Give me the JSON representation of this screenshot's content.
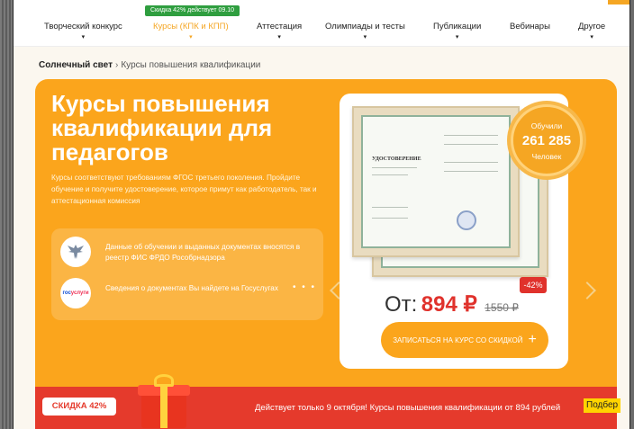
{
  "nav": {
    "promo_badge": "Скидка 42% действует 09.10",
    "items": [
      {
        "label": "Творческий конкурс",
        "chevron": "▾"
      },
      {
        "label": "Курсы (КПК и КПП)",
        "chevron": "▾"
      },
      {
        "label": "Аттестация",
        "chevron": "▾"
      },
      {
        "label": "Олимпиады и тесты",
        "chevron": "▾"
      },
      {
        "label": "Публикации",
        "chevron": "▾"
      },
      {
        "label": "Вебинары",
        "chevron": ""
      },
      {
        "label": "Другое",
        "chevron": "▾"
      }
    ],
    "active_color": "#f5a623"
  },
  "breadcrumb": {
    "home": "Солнечный свет",
    "separator": "›",
    "current": "Курсы повышения квалификации"
  },
  "hero": {
    "title": "Курсы повышения квалификации для педагогов",
    "subtitle": "Курсы соответствуют требованиям ФГОС третьего поколения. Пройдите обучение и получите удостоверение, которое примут как работодатель, так и аттестационная комиссия",
    "info": [
      {
        "icon": "eagle-emblem-icon",
        "text": "Данные об обучении и выданных документах вносятся в реестр ФИС ФРДО Рособрнадзора"
      },
      {
        "icon": "gosuslugi-logo",
        "text": "Сведения о документах Вы найдете на Госуслугах",
        "logo_text_a": "гос",
        "logo_text_b": "услуги"
      }
    ],
    "dots": "• • •",
    "background": "#fba51c"
  },
  "certificate": {
    "heading": "УДОСТОВЕРЕНИЕ"
  },
  "medal": {
    "line1": "Обучили",
    "count": "261 285",
    "line3": "Человек"
  },
  "pricing": {
    "discount": "-42%",
    "prefix": "От:",
    "price": "894 ₽",
    "old_price": "1550 ₽",
    "cta": "ЗАПИСАТЬСЯ НА КУРС СО СКИДКОЙ",
    "cta_icon": "+"
  },
  "ribbon": {
    "tag": "СКИДКА 42%",
    "text": "Действует только 9 октября! Курсы повышения квалификации от 894 рублей",
    "color": "#e53a2c"
  },
  "pick_button": "Подбер"
}
